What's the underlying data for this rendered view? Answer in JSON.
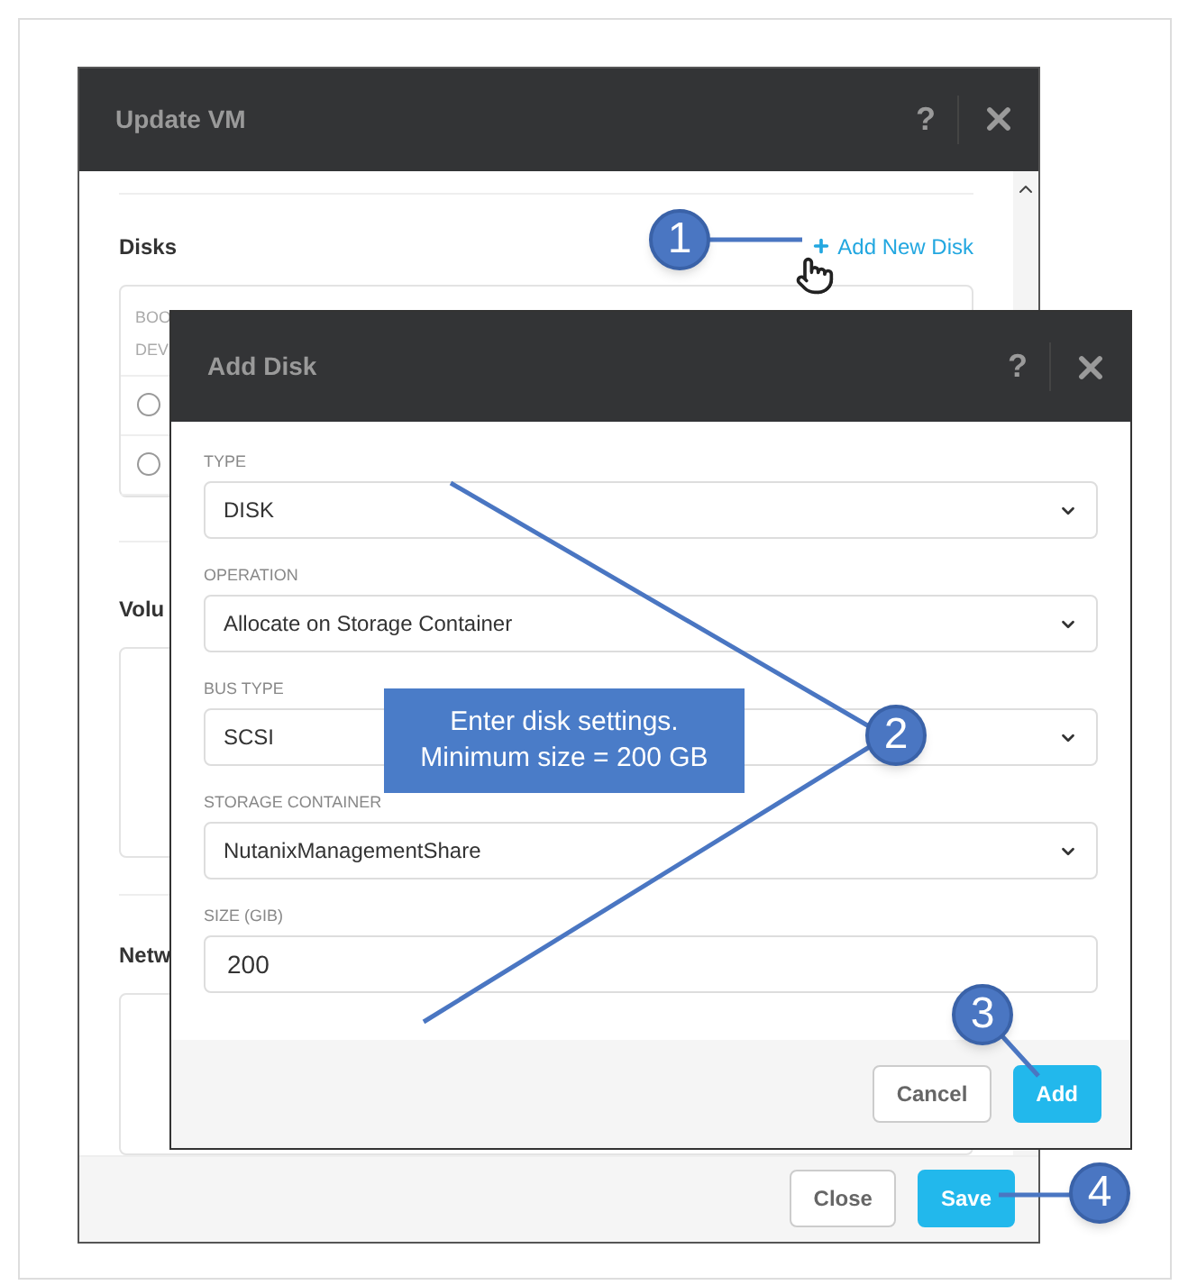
{
  "update_vm": {
    "title": "Update VM",
    "help": "?",
    "disks_heading": "Disks",
    "add_link": "Add New Disk",
    "column_1_lines": [
      "BOO",
      "DEV"
    ],
    "rows": [
      {
        "selected": false
      },
      {
        "selected": false
      }
    ],
    "volumes_heading": "Volu",
    "networks_heading": "Netw",
    "buttons": [
      {
        "label": "Close",
        "kind": "secondary"
      },
      {
        "label": "Save",
        "kind": "primary"
      }
    ]
  },
  "add_disk": {
    "title": "Add Disk",
    "help": "?",
    "fields": [
      {
        "label": "TYPE",
        "value": "DISK",
        "kind": "select"
      },
      {
        "label": "OPERATION",
        "value": "Allocate on Storage Container",
        "kind": "select"
      },
      {
        "label": "BUS TYPE",
        "value": "SCSI",
        "kind": "select"
      },
      {
        "label": "STORAGE CONTAINER",
        "value": "NutanixManagementShare",
        "kind": "select"
      },
      {
        "label": "SIZE (GIB)",
        "value": "200",
        "kind": "input"
      }
    ],
    "buttons": [
      {
        "label": "Cancel",
        "kind": "secondary"
      },
      {
        "label": "Add",
        "kind": "primary"
      }
    ]
  },
  "callout": {
    "text": "Enter disk settings.\nMinimum size = 200 GB"
  },
  "markers": [
    {
      "label": "1"
    },
    {
      "label": "2"
    },
    {
      "label": "3"
    },
    {
      "label": "4"
    }
  ]
}
